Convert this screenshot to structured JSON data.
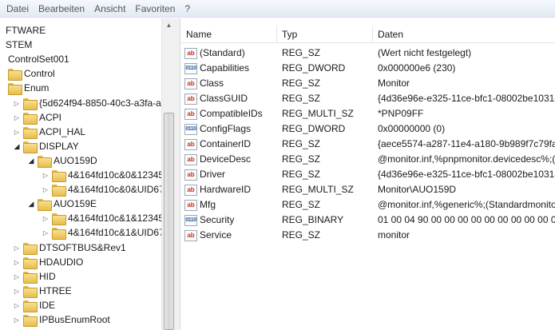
{
  "menu": [
    "Datei",
    "Bearbeiten",
    "Ansicht",
    "Favoriten",
    "?"
  ],
  "tree": [
    {
      "label": "FTWARE",
      "expander": "",
      "folder": false
    },
    {
      "label": "STEM",
      "expander": "",
      "folder": false
    },
    {
      "label": "ControlSet001",
      "expander": "",
      "folder": false
    },
    {
      "label": "Control",
      "expander": "",
      "folder": true
    },
    {
      "label": "Enum",
      "expander": "",
      "folder": true
    },
    {
      "label": "{5d624f94-8850-40c3-a3fa-a4",
      "expander": "collapsed",
      "folder": true
    },
    {
      "label": "ACPI",
      "expander": "collapsed",
      "folder": true
    },
    {
      "label": "ACPI_HAL",
      "expander": "collapsed",
      "folder": true
    },
    {
      "label": "DISPLAY",
      "expander": "expanded",
      "folder": true
    },
    {
      "label": "AUO159D",
      "expander": "expanded",
      "folder": true
    },
    {
      "label": "4&164fd10c&0&12345",
      "expander": "collapsed",
      "folder": true
    },
    {
      "label": "4&164fd10c&0&UID67",
      "expander": "collapsed",
      "folder": true
    },
    {
      "label": "AUO159E",
      "expander": "expanded",
      "folder": true
    },
    {
      "label": "4&164fd10c&1&12345",
      "expander": "collapsed",
      "folder": true
    },
    {
      "label": "4&164fd10c&1&UID67",
      "expander": "collapsed",
      "folder": true
    },
    {
      "label": "DTSOFTBUS&Rev1",
      "expander": "collapsed",
      "folder": true
    },
    {
      "label": "HDAUDIO",
      "expander": "collapsed",
      "folder": true
    },
    {
      "label": "HID",
      "expander": "collapsed",
      "folder": true
    },
    {
      "label": "HTREE",
      "expander": "collapsed",
      "folder": true
    },
    {
      "label": "IDE",
      "expander": "collapsed",
      "folder": true
    },
    {
      "label": "IPBusEnumRoot",
      "expander": "collapsed",
      "folder": true
    }
  ],
  "list": {
    "columns": {
      "name": "Name",
      "type": "Typ",
      "data": "Daten"
    },
    "rows": [
      {
        "icon": "string-value-icon",
        "name": "(Standard)",
        "type": "REG_SZ",
        "data": "(Wert nicht festgelegt)"
      },
      {
        "icon": "binary-value-icon",
        "name": "Capabilities",
        "type": "REG_DWORD",
        "data": "0x000000e6 (230)"
      },
      {
        "icon": "string-value-icon",
        "name": "Class",
        "type": "REG_SZ",
        "data": "Monitor"
      },
      {
        "icon": "string-value-icon",
        "name": "ClassGUID",
        "type": "REG_SZ",
        "data": "{4d36e96e-e325-11ce-bfc1-08002be10318}"
      },
      {
        "icon": "string-value-icon",
        "name": "CompatibleIDs",
        "type": "REG_MULTI_SZ",
        "data": "*PNP09FF"
      },
      {
        "icon": "binary-value-icon",
        "name": "ConfigFlags",
        "type": "REG_DWORD",
        "data": "0x00000000 (0)"
      },
      {
        "icon": "string-value-icon",
        "name": "ContainerID",
        "type": "REG_SZ",
        "data": "{aece5574-a287-11e4-a180-9b989f7c79fa}"
      },
      {
        "icon": "string-value-icon",
        "name": "DeviceDesc",
        "type": "REG_SZ",
        "data": "@monitor.inf,%pnpmonitor.devicedesc%;("
      },
      {
        "icon": "string-value-icon",
        "name": "Driver",
        "type": "REG_SZ",
        "data": "{4d36e96e-e325-11ce-bfc1-08002be10318}"
      },
      {
        "icon": "string-value-icon",
        "name": "HardwareID",
        "type": "REG_MULTI_SZ",
        "data": "Monitor\\AUO159D"
      },
      {
        "icon": "string-value-icon",
        "name": "Mfg",
        "type": "REG_SZ",
        "data": "@monitor.inf,%generic%;(Standardmonito"
      },
      {
        "icon": "binary-value-icon",
        "name": "Security",
        "type": "REG_BINARY",
        "data": "01 00 04 90 00 00 00 00 00 00 00 00 00 00 00"
      },
      {
        "icon": "string-value-icon",
        "name": "Service",
        "type": "REG_SZ",
        "data": "monitor"
      }
    ]
  }
}
